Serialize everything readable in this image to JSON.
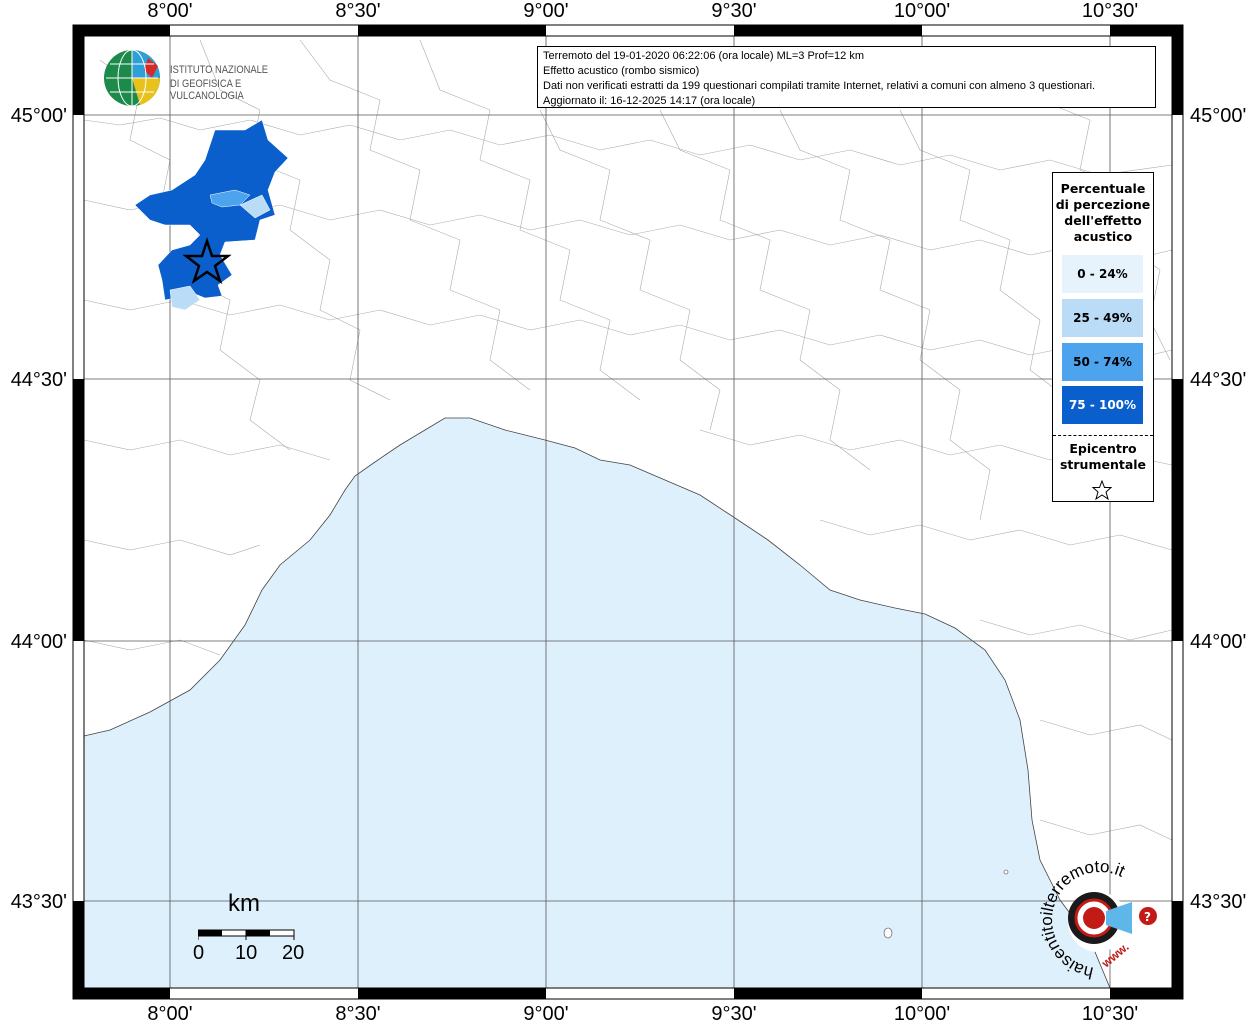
{
  "map": {
    "lon_labels": [
      "8°00'",
      "8°30'",
      "9°00'",
      "9°30'",
      "10°00'",
      "10°30'"
    ],
    "lat_labels": [
      "45°00'",
      "44°30'",
      "44°00'",
      "43°30'"
    ],
    "sea_color": "#dff0fd",
    "land_color": "#ffffff",
    "border_color": "#999999"
  },
  "ingv_logo": {
    "line1": "ISTITUTO NAZIONALE",
    "line2": "DI GEOFISICA E VULCANOLOGIA"
  },
  "info": {
    "line1": "Terremoto del 19-01-2020 06:22:06 (ora locale) ML=3 Prof=12 km",
    "line2": "Effetto acustico (rombo sismico)",
    "line3": "Dati non verificati estratti da 199 questionari compilati tramite Internet, relativi a comuni con almeno 3 questionari.",
    "line4": "Aggiornato il: 16-12-2025 14:17 (ora locale)"
  },
  "legend": {
    "title": "Percentuale di percezione dell'effetto acustico",
    "items": [
      {
        "label": "0 - 24%",
        "color": "#e6f3fc",
        "text_color": "#000000"
      },
      {
        "label": "25 - 49%",
        "color": "#bbdcf7",
        "text_color": "#000000"
      },
      {
        "label": "50 - 74%",
        "color": "#4da3ee",
        "text_color": "#000000"
      },
      {
        "label": "75 - 100%",
        "color": "#0b5fcd",
        "text_color": "#ffffff"
      }
    ],
    "epicenter_label": "Epicentro strumentale"
  },
  "scale_bar": {
    "unit": "km",
    "ticks": [
      "0",
      "10",
      "20"
    ]
  },
  "hsl_logo": {
    "text": "haisentitoilterremoto.it",
    "url": "www."
  }
}
